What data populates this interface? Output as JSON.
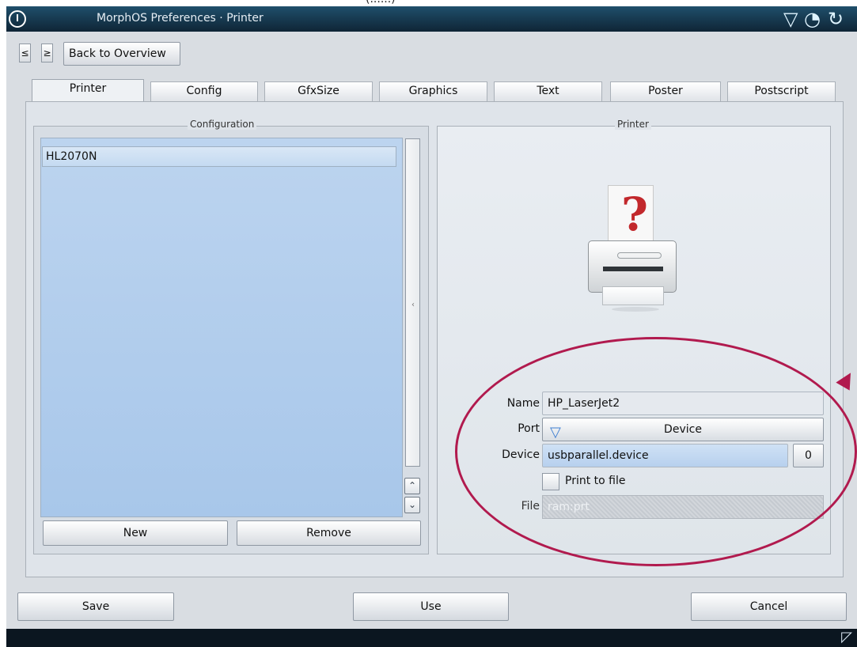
{
  "clipped_top_text": "(......)",
  "window": {
    "title": "MorphOS Preferences · Printer",
    "icons": [
      "system-menu-icon",
      "down-triangle-icon",
      "dial-icon",
      "refresh-icon"
    ]
  },
  "toolbar": {
    "prev_label": "≤",
    "next_label": "≥",
    "back_label": "Back to Overview"
  },
  "tabs": [
    "Printer",
    "Config",
    "GfxSize",
    "Graphics",
    "Text",
    "Poster",
    "Postscript"
  ],
  "left_group": {
    "title": "Configuration",
    "items": [
      "HL2070N"
    ],
    "new_label": "New",
    "remove_label": "Remove"
  },
  "right_group": {
    "title": "Printer",
    "name_label": "Name",
    "name_value": "HP_LaserJet2",
    "port_label": "Port",
    "port_value": "Device",
    "device_label": "Device",
    "device_value": "usbparallel.device",
    "unit_value": "0",
    "print_to_file_label": "Print to file",
    "file_label": "File",
    "file_value": "ram:prt"
  },
  "bottom": {
    "save_label": "Save",
    "use_label": "Use",
    "cancel_label": "Cancel"
  },
  "colors": {
    "titlebar": "#0f2536",
    "panel": "#d9dde2",
    "list_bg": "#a8c7ea",
    "annotation": "#b11a4e"
  }
}
